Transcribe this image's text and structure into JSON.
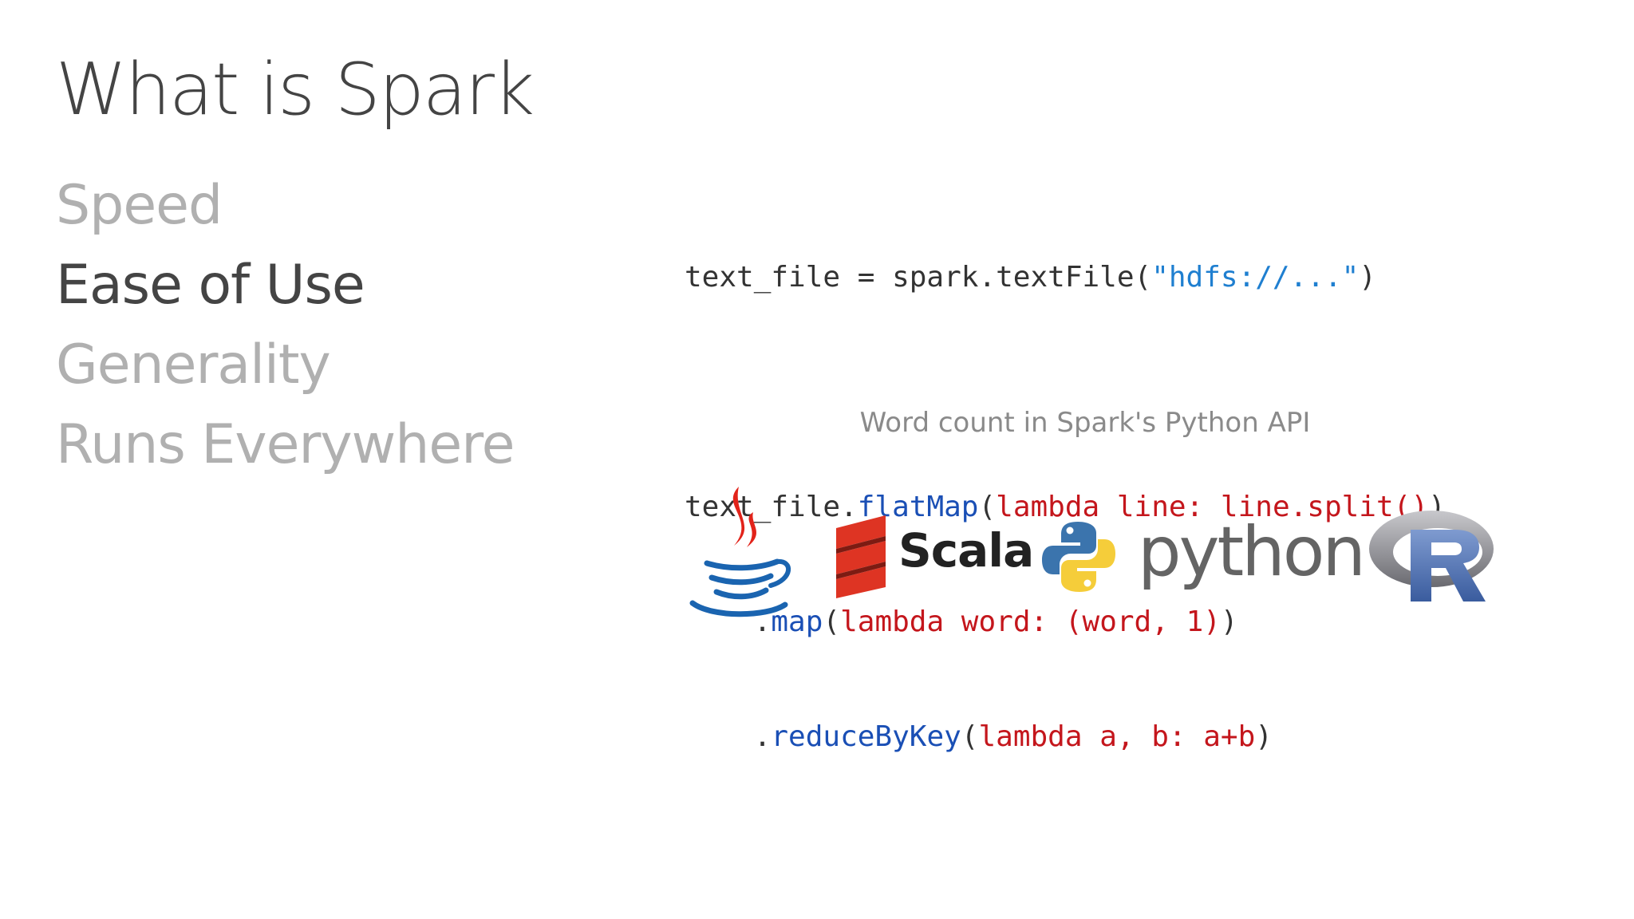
{
  "slide": {
    "title": "What is Spark",
    "bullets": [
      {
        "label": "Speed",
        "active": false
      },
      {
        "label": "Ease of Use",
        "active": true
      },
      {
        "label": "Generality",
        "active": false
      },
      {
        "label": "Runs Everywhere",
        "active": false
      }
    ]
  },
  "code": {
    "line1": {
      "a": "text_file = spark.textFile(",
      "b": "\"hdfs://...\"",
      "c": ")"
    },
    "line2": {
      "a": "text_file.",
      "b": "flatMap",
      "c": "(",
      "d": "lambda line: line.split()",
      "e": ")"
    },
    "line3": {
      "indent": "    .",
      "b": "map",
      "c": "(",
      "d": "lambda word: (word, 1)",
      "e": ")"
    },
    "line4": {
      "indent": "    .",
      "b": "reduceByKey",
      "c": "(",
      "d": "lambda a, b: a+b",
      "e": ")"
    }
  },
  "caption": "Word count in Spark's Python API",
  "logos": {
    "java_icon": "java-icon",
    "scala_label": "Scala",
    "python_label": "python",
    "r_label": "R"
  },
  "colors": {
    "title": "#444444",
    "bullet_inactive": "#b0b0b0",
    "bullet_active": "#444444",
    "code_plain": "#333333",
    "code_string": "#1f7fd0",
    "code_method": "#1a4fb5",
    "code_lambda": "#c4161c",
    "caption": "#8a8a8a"
  }
}
